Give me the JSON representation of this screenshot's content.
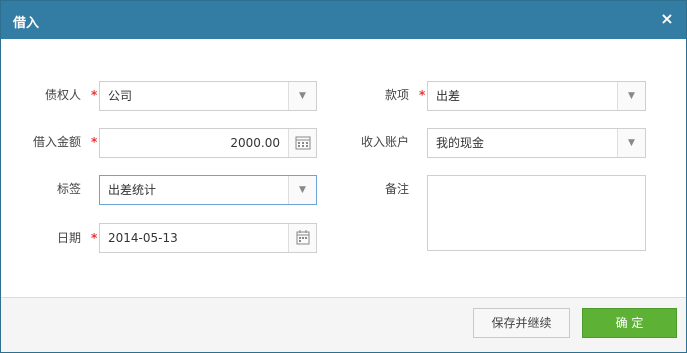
{
  "dialog": {
    "title": "借入",
    "close_glyph": "×"
  },
  "form": {
    "creditor": {
      "label": "债权人",
      "value": "公司"
    },
    "amount": {
      "label": "借入金额",
      "value": "2000.00"
    },
    "tag": {
      "label": "标签",
      "value": "出差统计"
    },
    "date": {
      "label": "日期",
      "value": "2014-05-13"
    },
    "item": {
      "label": "款项",
      "value": "出差"
    },
    "account": {
      "label": "收入账户",
      "value": "我的现金"
    },
    "memo": {
      "label": "备注",
      "value": ""
    },
    "required_mark": "*"
  },
  "footer": {
    "save_continue_label": "保存并继续",
    "ok_label": "确 定"
  },
  "colors": {
    "titlebar": "#337ca3",
    "ok_button": "#5db236",
    "required": "#e33333"
  }
}
